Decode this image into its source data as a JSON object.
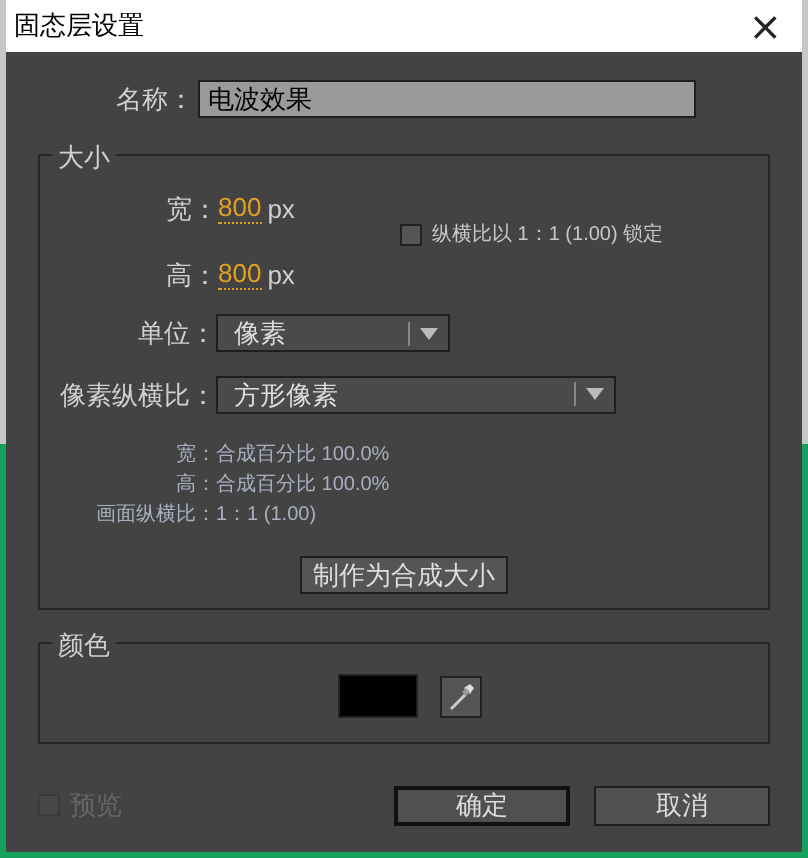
{
  "window": {
    "title": "固态层设置",
    "close": "×"
  },
  "name": {
    "label": "名称：",
    "value": "电波效果"
  },
  "size": {
    "legend": "大小",
    "width": {
      "label": "宽：",
      "value": "800",
      "unit": "px"
    },
    "height": {
      "label": "高：",
      "value": "800",
      "unit": "px"
    },
    "lock": {
      "label": "纵横比以 1：1 (1.00) 锁定",
      "checked": false
    },
    "units": {
      "label": "单位：",
      "value": "像素"
    },
    "pixel_aspect": {
      "label": "像素纵横比：",
      "value": "方形像素"
    },
    "info": [
      {
        "label": "宽：",
        "value": "合成百分比 100.0%"
      },
      {
        "label": "高：",
        "value": "合成百分比 100.0%"
      },
      {
        "label": "画面纵横比：",
        "value": "1：1 (1.00)"
      }
    ],
    "make_comp_size": "制作为合成大小"
  },
  "color": {
    "legend": "颜色",
    "color": "#000000"
  },
  "preview": {
    "label": "预览",
    "checked": false,
    "disabled": true
  },
  "buttons": [
    {
      "label": "确定",
      "default": true
    },
    {
      "label": "取消",
      "default": false
    }
  ]
}
